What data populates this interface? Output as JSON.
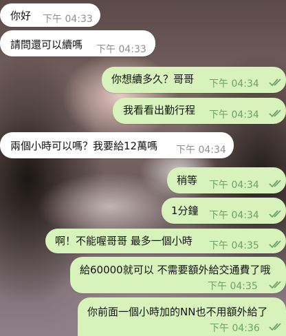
{
  "chat": {
    "messages": [
      {
        "dir": "in",
        "text": "你好",
        "time": "下午 04:33"
      },
      {
        "dir": "in",
        "text": "請問還可以續嗎",
        "time": "下午 04:33"
      },
      {
        "dir": "out",
        "text": "你想續多久？哥哥",
        "time": "下午 04:34",
        "status": "read"
      },
      {
        "dir": "out",
        "text": "我看看出勤行程",
        "time": "下午 04:34",
        "status": "read"
      },
      {
        "dir": "in",
        "text": "兩個小時可以嗎？我要給12萬嗎",
        "time": "下午 04:34"
      },
      {
        "dir": "out",
        "text": "稍等",
        "time": "下午 04:34",
        "status": "read"
      },
      {
        "dir": "out",
        "text": "1分鐘",
        "time": "下午 04:34",
        "status": "read"
      },
      {
        "dir": "out",
        "text": "啊！不能喔哥哥 最多一個小時",
        "time": "下午 04:35",
        "status": "read"
      },
      {
        "dir": "out",
        "text": "給60000就可以 不需要額外給交通費了哦",
        "time": "下午 04:35",
        "status": "read"
      },
      {
        "dir": "out",
        "text": "你前面一個小時加的NN也不用額外給了",
        "time": "下午 04:36",
        "status": "read"
      }
    ]
  },
  "colors": {
    "incoming_bubble": "#ffffff",
    "outgoing_bubble": "#d8f2bb",
    "outgoing_meta": "#6aa36a",
    "incoming_meta": "#8f8f8f"
  },
  "icons": {
    "read_receipt": "double-check-icon"
  }
}
